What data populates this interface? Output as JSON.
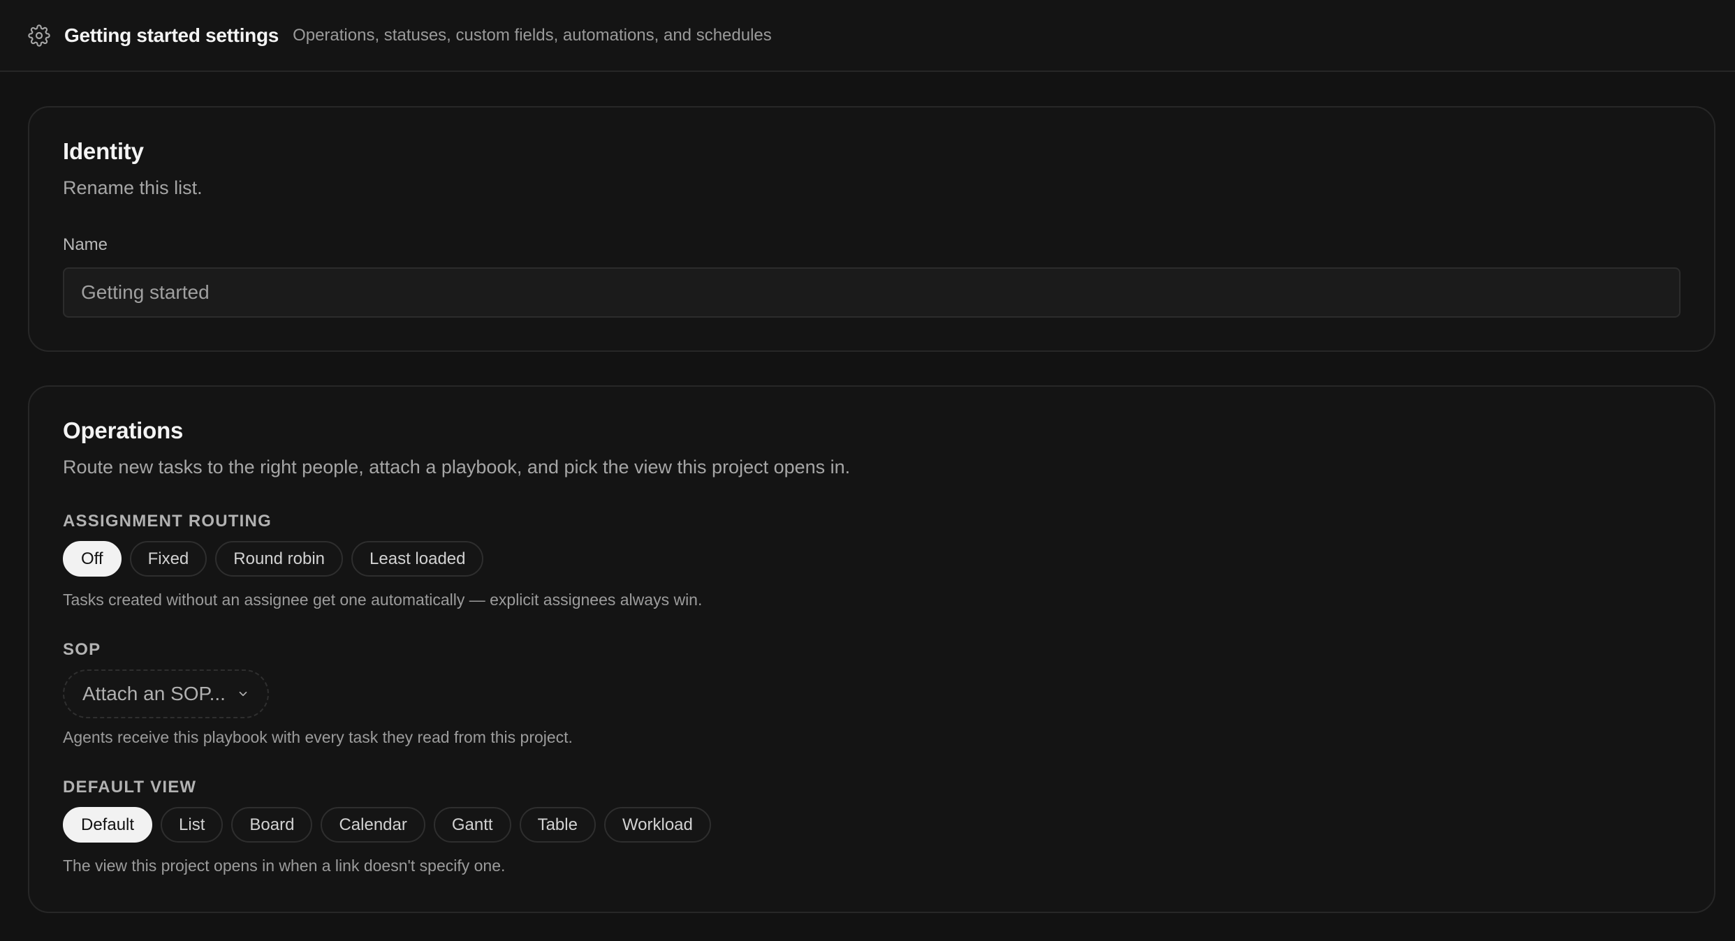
{
  "header": {
    "title": "Getting started settings",
    "subtitle": "Operations, statuses, custom fields, automations, and schedules",
    "icon": "gear-icon"
  },
  "identity": {
    "heading": "Identity",
    "description": "Rename this list.",
    "name_label": "Name",
    "name_value": "Getting started"
  },
  "operations": {
    "heading": "Operations",
    "description": "Route new tasks to the right people, attach a playbook, and pick the view this project opens in.",
    "routing": {
      "label": "ASSIGNMENT ROUTING",
      "options": [
        "Off",
        "Fixed",
        "Round robin",
        "Least loaded"
      ],
      "selected": "Off",
      "hint": "Tasks created without an assignee get one automatically — explicit assignees always win."
    },
    "sop": {
      "label": "SOP",
      "placeholder": "Attach an SOP...",
      "hint": "Agents receive this playbook with every task they read from this project."
    },
    "default_view": {
      "label": "DEFAULT VIEW",
      "options": [
        "Default",
        "List",
        "Board",
        "Calendar",
        "Gantt",
        "Table",
        "Workload"
      ],
      "selected": "Default",
      "hint": "The view this project opens in when a link doesn't specify one."
    }
  }
}
